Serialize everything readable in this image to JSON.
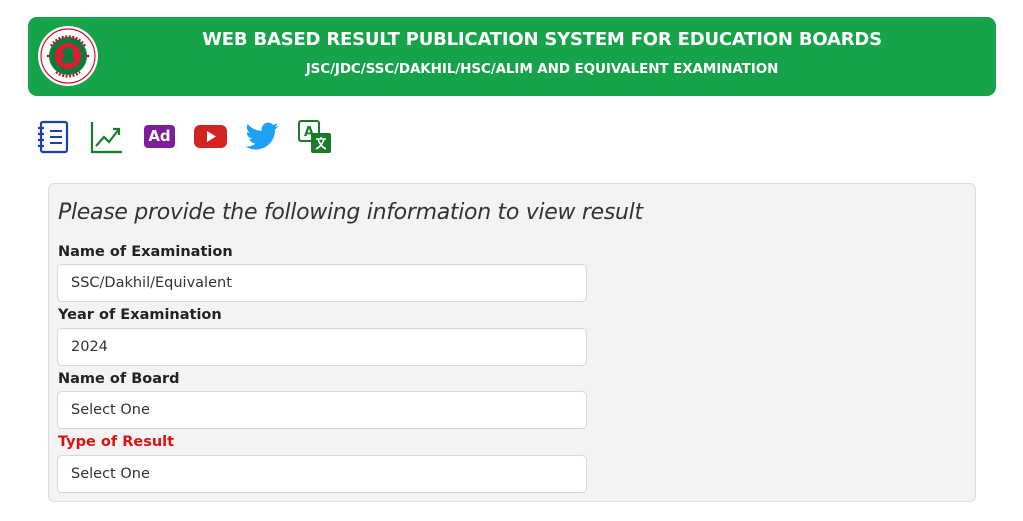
{
  "header": {
    "title": "WEB BASED RESULT PUBLICATION SYSTEM FOR EDUCATION BOARDS",
    "subtitle": "JSC/JDC/SSC/DAKHIL/HSC/ALIM AND EQUIVALENT EXAMINATION",
    "logo_icon": "government-seal-icon",
    "background_color": "#16a34a"
  },
  "toolbar": {
    "items": [
      {
        "icon": "notebook-icon",
        "color": "#1d3fa8"
      },
      {
        "icon": "trend-chart-icon",
        "color": "#1a7a2c"
      },
      {
        "icon": "ad-icon",
        "label": "Ad",
        "color": "#7e1e9c"
      },
      {
        "icon": "youtube-icon",
        "color": "#d32323"
      },
      {
        "icon": "twitter-icon",
        "color": "#1da1f2"
      },
      {
        "icon": "translate-icon",
        "color": "#1a7a2c"
      }
    ]
  },
  "form": {
    "heading": "Please provide the following information to view result",
    "fields": [
      {
        "label": "Name of Examination",
        "value": "SSC/Dakhil/Equivalent",
        "required_highlight": false
      },
      {
        "label": "Year of Examination",
        "value": "2024",
        "required_highlight": false
      },
      {
        "label": "Name of Board",
        "value": "Select One",
        "required_highlight": false
      },
      {
        "label": "Type of Result",
        "value": "Select One",
        "required_highlight": true
      }
    ],
    "label_color": "#222222",
    "highlight_color": "#dd1111"
  }
}
